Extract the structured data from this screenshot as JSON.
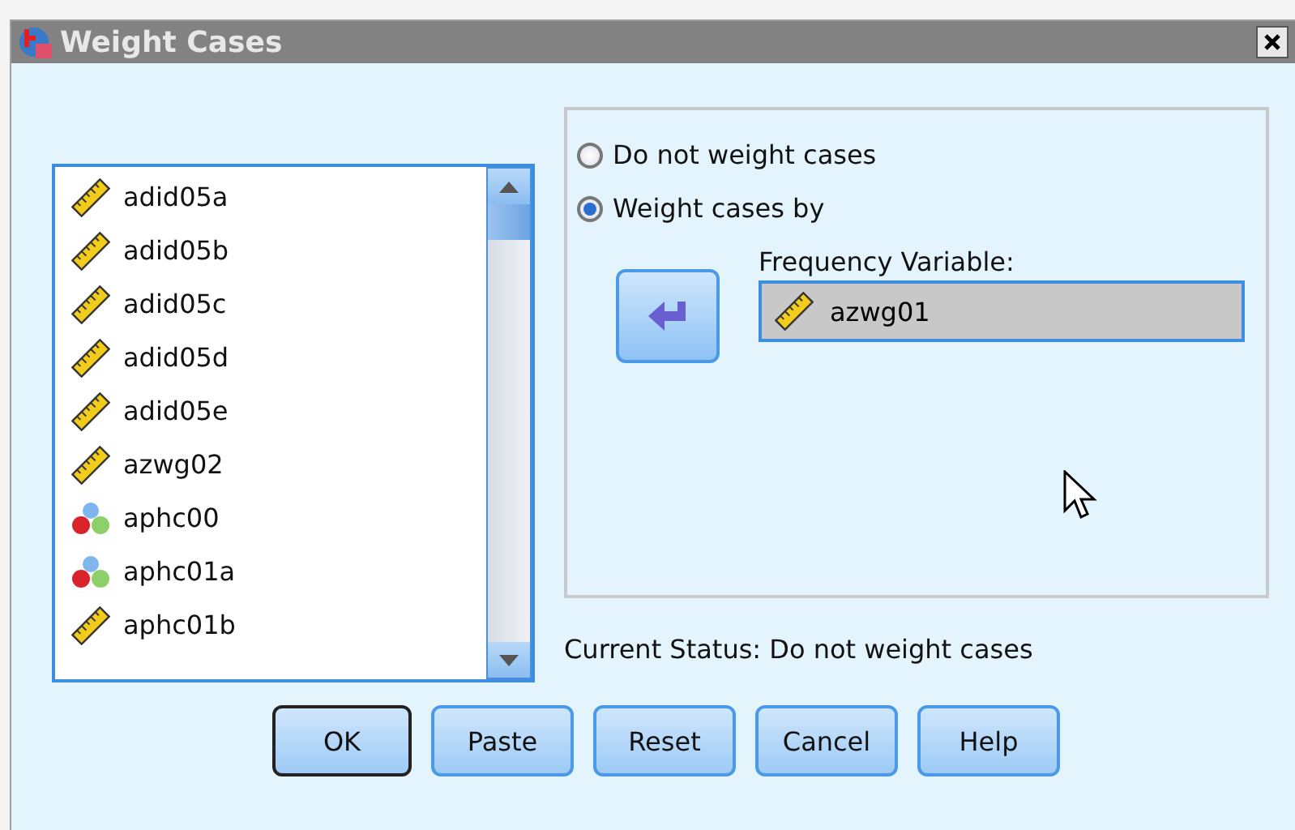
{
  "window": {
    "title": "Weight Cases"
  },
  "variables": [
    {
      "name": "adid05a",
      "kind": "scale"
    },
    {
      "name": "adid05b",
      "kind": "scale"
    },
    {
      "name": "adid05c",
      "kind": "scale"
    },
    {
      "name": "adid05d",
      "kind": "scale"
    },
    {
      "name": "adid05e",
      "kind": "scale"
    },
    {
      "name": "azwg02",
      "kind": "scale"
    },
    {
      "name": "aphc00",
      "kind": "nominal"
    },
    {
      "name": "aphc01a",
      "kind": "nominal"
    },
    {
      "name": "aphc01b",
      "kind": "scale"
    }
  ],
  "options": [
    {
      "label": "Do not weight cases",
      "selected": false
    },
    {
      "label": "Weight cases by",
      "selected": true
    }
  ],
  "frequency_variable": {
    "label": "Frequency Variable:",
    "value": "azwg01",
    "kind": "scale"
  },
  "current_status": "Current Status: Do not weight cases",
  "buttons": [
    {
      "label": "OK",
      "default": true
    },
    {
      "label": "Paste",
      "default": false
    },
    {
      "label": "Reset",
      "default": false
    },
    {
      "label": "Cancel",
      "default": false
    },
    {
      "label": "Help",
      "default": false
    }
  ]
}
